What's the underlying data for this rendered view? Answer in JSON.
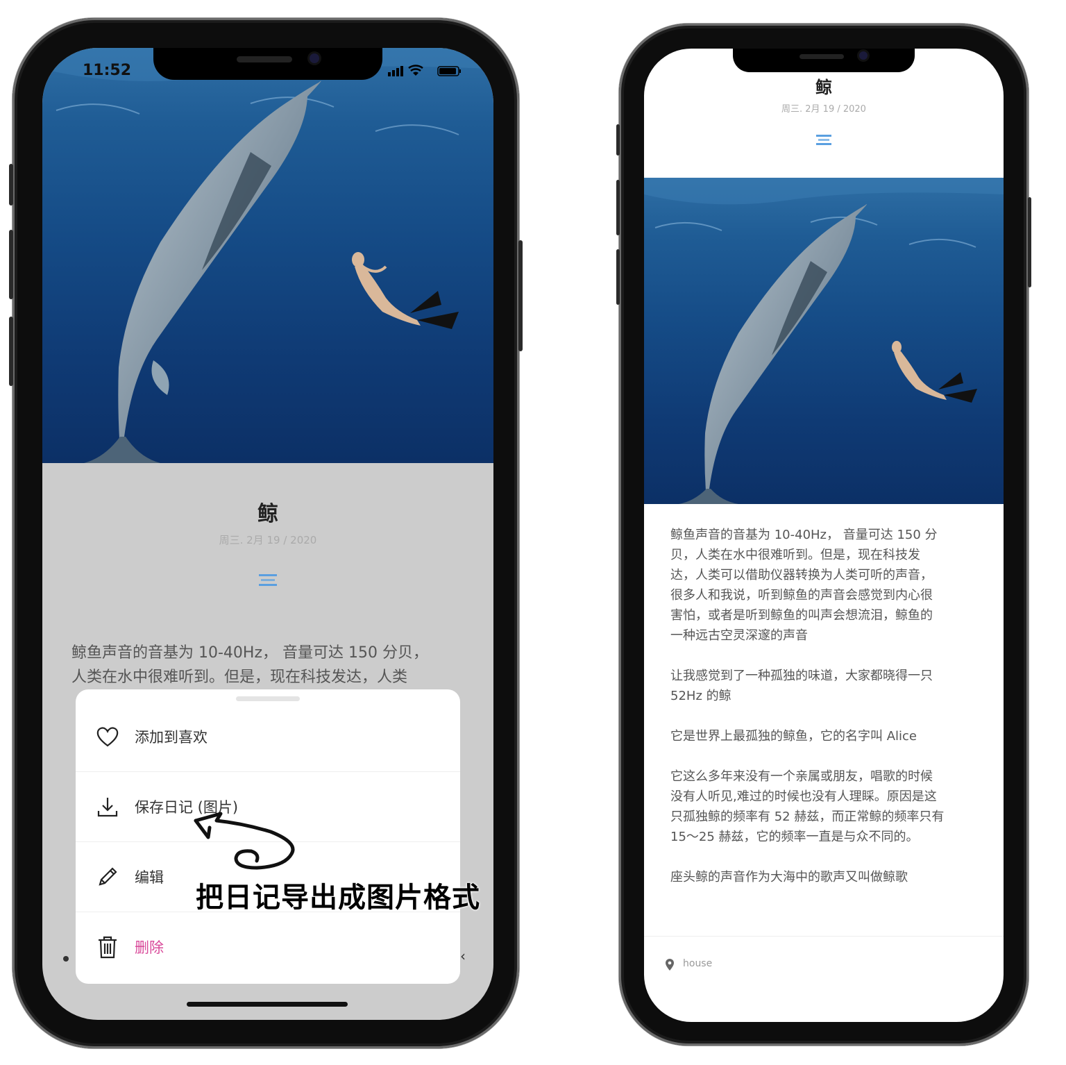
{
  "left_phone": {
    "status_bar": {
      "time": "11:52"
    },
    "article": {
      "title": "鲸",
      "date": "周三. 2月 19 / 2020",
      "body_line1": "鲸鱼声音的音基为 10-40Hz， 音量可达 150 分贝，",
      "body_line2": "人类在水中很难听到。但是，现在科技发达，人类"
    },
    "action_sheet": {
      "items": [
        {
          "label": "添加到喜欢",
          "icon": "heart-icon"
        },
        {
          "label": "保存日记 (图片)",
          "icon": "download-icon"
        },
        {
          "label": "编辑",
          "icon": "pencil-icon"
        },
        {
          "label": "删除",
          "icon": "trash-icon",
          "color": "#d94a9a"
        }
      ]
    },
    "annotation": "把日记导出成图片格式"
  },
  "right_phone": {
    "article": {
      "title": "鲸",
      "date": "周三. 2月 19 / 2020",
      "paragraphs": [
        [
          "鲸鱼声音的音基为 10-40Hz， 音量可达 150 分",
          "贝，人类在水中很难听到。但是，现在科技发",
          "达，人类可以借助仪器转换为人类可听的声音，",
          "很多人和我说，听到鲸鱼的声音会感觉到内心很",
          "害怕，或者是听到鲸鱼的叫声会想流泪，鲸鱼的",
          "一种远古空灵深邃的声音"
        ],
        [
          "让我感觉到了一种孤独的味道，大家都晓得一只",
          "52Hz 的鲸"
        ],
        [
          "它是世界上最孤独的鲸鱼，它的名字叫 Alice"
        ],
        [
          "它这么多年来没有一个亲属或朋友，唱歌的时候",
          "没有人听见,难过的时候也没有人理睬。原因是这",
          "只孤独鲸的频率有 52 赫兹，而正常鲸的频率只有",
          "15～25 赫兹，它的频率一直是与众不同的。"
        ],
        [
          "座头鲸的声音作为大海中的歌声又叫做鲸歌"
        ]
      ]
    },
    "location": {
      "label": "house",
      "icon": "location-pin-icon"
    }
  },
  "colors": {
    "sheet_overlay": "#cccccc",
    "accent_blue": "#5a9fe0",
    "delete_pink": "#d94a9a"
  }
}
